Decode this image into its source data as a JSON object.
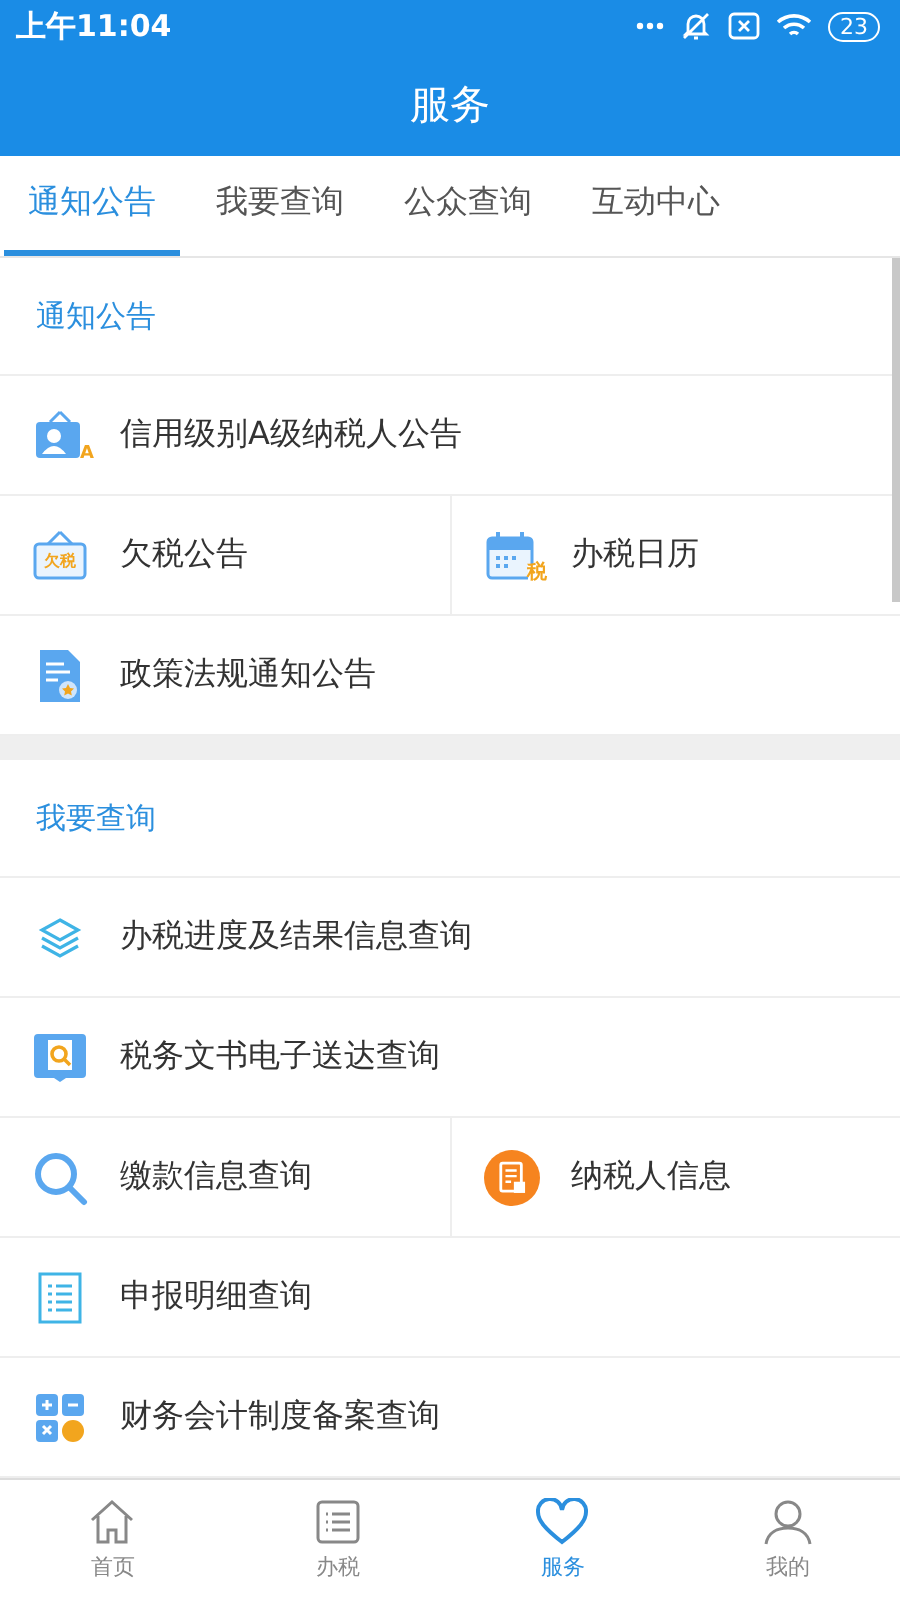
{
  "status_bar": {
    "time": "上午11:04",
    "battery": "23"
  },
  "header": {
    "title": "服务"
  },
  "tabs": [
    {
      "label": "通知公告",
      "selected": true
    },
    {
      "label": "我要查询",
      "selected": false
    },
    {
      "label": "公众查询",
      "selected": false
    },
    {
      "label": "互动中心",
      "selected": false
    }
  ],
  "sections": [
    {
      "title": "通知公告",
      "rows": [
        [
          {
            "kind": "credit",
            "label": "信用级别A级纳税人公告",
            "icon_text": "A"
          }
        ],
        [
          {
            "kind": "arrears",
            "label": "欠税公告",
            "icon_text": "欠税"
          },
          {
            "kind": "calendar",
            "label": "办税日历",
            "icon_text": "税"
          }
        ],
        [
          {
            "kind": "policy",
            "label": "政策法规通知公告"
          }
        ]
      ]
    },
    {
      "title": "我要查询",
      "rows": [
        [
          {
            "kind": "layers",
            "label": "办税进度及结果信息查询"
          }
        ],
        [
          {
            "kind": "document-search",
            "label": "税务文书电子送达查询"
          }
        ],
        [
          {
            "kind": "search",
            "label": "缴款信息查询"
          },
          {
            "kind": "taxpayer",
            "label": "纳税人信息"
          }
        ],
        [
          {
            "kind": "list",
            "label": "申报明细查询"
          }
        ],
        [
          {
            "kind": "calculator",
            "label": "财务会计制度备案查询"
          }
        ]
      ]
    }
  ],
  "bottom_nav": [
    {
      "kind": "home",
      "label": "首页",
      "selected": false
    },
    {
      "kind": "list",
      "label": "办税",
      "selected": false
    },
    {
      "kind": "heart",
      "label": "服务",
      "selected": true
    },
    {
      "kind": "person",
      "label": "我的",
      "selected": false
    }
  ]
}
